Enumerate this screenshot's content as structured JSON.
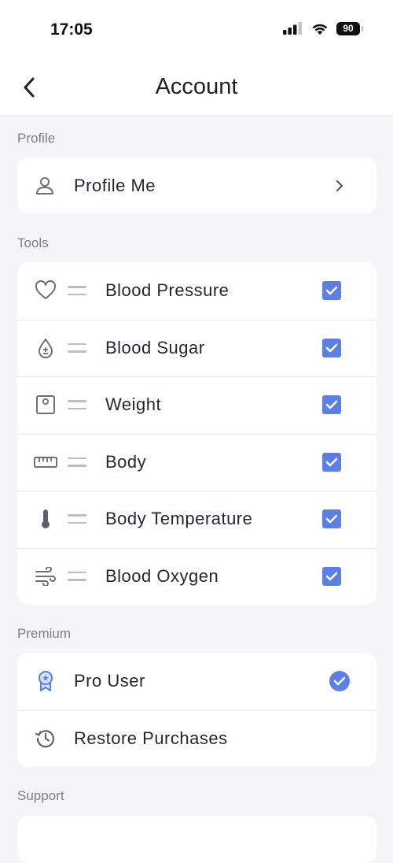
{
  "status_bar": {
    "time": "17:05",
    "battery": "90",
    "icons": [
      "cellular-signal-icon",
      "wifi-icon",
      "battery-icon"
    ]
  },
  "nav": {
    "title": "Account",
    "back_icon": "chevron-left-icon"
  },
  "sections": {
    "profile": {
      "label": "Profile",
      "items": [
        {
          "label": "Profile Me",
          "icon": "person-icon",
          "trailing": "chevron-right-icon"
        }
      ]
    },
    "tools": {
      "label": "Tools",
      "items": [
        {
          "label": "Blood Pressure",
          "icon": "heart-icon",
          "checked": true
        },
        {
          "label": "Blood Sugar",
          "icon": "blood-drop-icon",
          "checked": true
        },
        {
          "label": "Weight",
          "icon": "scale-icon",
          "checked": true
        },
        {
          "label": "Body",
          "icon": "ruler-icon",
          "checked": true
        },
        {
          "label": "Body Temperature",
          "icon": "thermometer-icon",
          "checked": true
        },
        {
          "label": "Blood Oxygen",
          "icon": "wind-icon",
          "checked": true
        }
      ]
    },
    "premium": {
      "label": "Premium",
      "items": [
        {
          "label": "Pro User",
          "icon": "award-badge-icon",
          "trailing": "check-circle-icon"
        },
        {
          "label": "Restore Purchases",
          "icon": "history-icon"
        }
      ]
    },
    "support": {
      "label": "Support"
    }
  },
  "colors": {
    "accent": "#5b7fe3",
    "background": "#f4f5f7",
    "card": "#ffffff",
    "icon_gray": "#6b707a"
  }
}
